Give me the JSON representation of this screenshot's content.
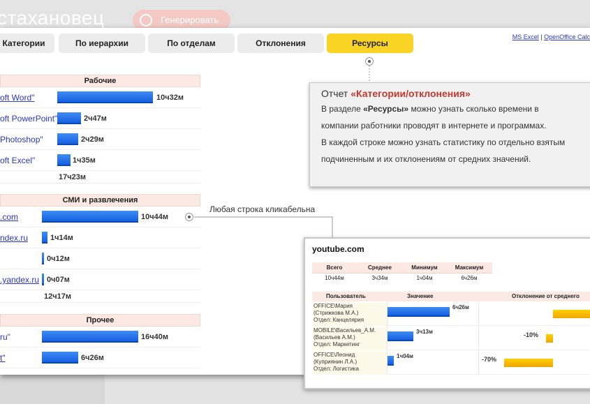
{
  "background": {
    "logo_text": "стахановец",
    "generate_label": "Генерировать"
  },
  "tabs": [
    {
      "label": "Категории",
      "active": false
    },
    {
      "label": "По иерархии",
      "active": false
    },
    {
      "label": "По отделам",
      "active": false
    },
    {
      "label": "Отклонения",
      "active": false
    },
    {
      "label": "Ресурсы",
      "active": true
    }
  ],
  "export": {
    "ms_excel": "MS Excel",
    "separator": "|",
    "openoffice": "OpenOffice Calc"
  },
  "groups": [
    {
      "title": "Рабочие",
      "total": "17ч23м",
      "rows": [
        {
          "name": "oft Word\"",
          "value": "10ч32м",
          "fraction": 0.99
        },
        {
          "name": "oft PowerPoint\"",
          "value": "2ч47м",
          "fraction": 0.26
        },
        {
          "name": "Photoshop\"",
          "value": "2ч29м",
          "fraction": 0.23
        },
        {
          "name": "oft Excel\"",
          "value": "1ч35м",
          "fraction": 0.15
        }
      ]
    },
    {
      "title": "СМИ и развлечения",
      "total": "12ч17м",
      "rows": [
        {
          "name": ".com",
          "value": "10ч44м",
          "fraction": 1.0
        },
        {
          "name": "ndex.ru",
          "value": "1ч14м",
          "fraction": 0.06
        },
        {
          "name": "",
          "value": "0ч12м",
          "fraction": 0.02
        },
        {
          "name": ".yandex.ru",
          "value": "0ч07м",
          "fraction": 0.01
        }
      ]
    },
    {
      "title": "Прочее",
      "rows": [
        {
          "name": "ru\"",
          "value": "16ч40м",
          "fraction": 1.0
        },
        {
          "name": "t\"",
          "value": "6ч26м",
          "fraction": 0.38
        }
      ]
    }
  ],
  "info": {
    "title_prefix": "Отчет",
    "title_highlight": "«Категории/отклонения»",
    "line1_prefix": "В разделе",
    "line1_bold": "«Ресурсы»",
    "line1_rest": "можно узнать сколько времени в",
    "line2": "компании работники проводят в интернете и программах.",
    "line3": "В каждой строке можно узнать статистику по отдельно взятым",
    "line4": "подчиненным и их отклонениям от средних значений."
  },
  "callout": "Любая строка кликабельна",
  "popup": {
    "title": "youtube.com",
    "stats_headers": [
      "Всего",
      "Среднее",
      "Минимум",
      "Максимум"
    ],
    "stats_values": [
      "10ч44м",
      "3ч34м",
      "1ч04м",
      "6ч26м"
    ],
    "columns": {
      "user": "Пользователь",
      "value": "Значение",
      "deviation": "Отклонение от среднего"
    },
    "users": [
      {
        "lines": [
          "OFFICE\\Мария",
          "(Стрижкова М.А.)",
          "Отдел: Канцелярия"
        ],
        "value": "6ч26м",
        "fraction": 1.0,
        "deviation": "",
        "deviation_pct": 80
      },
      {
        "lines": [
          "MOBILE\\Васильев_А.М.",
          "(Васильев А.М.)",
          "Отдел: Маркетинг"
        ],
        "value": "3ч13м",
        "fraction": 0.42,
        "deviation": "-10%",
        "deviation_pct": -10
      },
      {
        "lines": [
          "OFFICE\\Леонид",
          "(Куприянин Л.А.)",
          "Отдел: Логистика"
        ],
        "value": "1ч04м",
        "fraction": 0.1,
        "deviation": "-70%",
        "deviation_pct": -70
      }
    ]
  }
}
